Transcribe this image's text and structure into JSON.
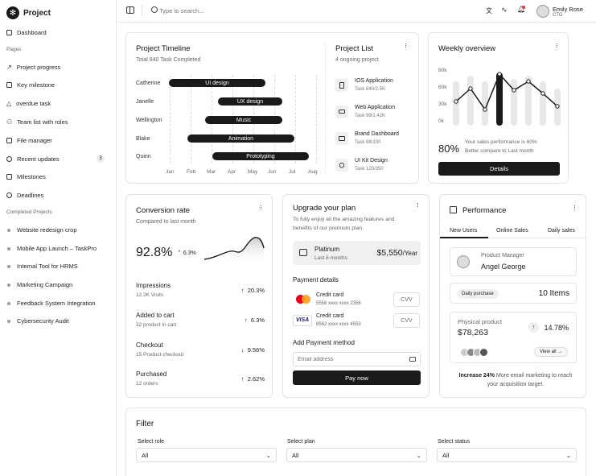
{
  "app": {
    "name": "Project"
  },
  "sidebar": {
    "main": [
      {
        "label": "Dashboard"
      }
    ],
    "pages_header": "Pages",
    "pages": [
      {
        "label": "Project progress"
      },
      {
        "label": "Key milestone"
      },
      {
        "label": "overdue task"
      },
      {
        "label": "Team list with roles"
      },
      {
        "label": "File manager"
      },
      {
        "label": "Recent updates",
        "badge": "3"
      },
      {
        "label": "Milestones"
      },
      {
        "label": "Deadlines"
      }
    ],
    "completed_header": "Completed Projects",
    "completed": [
      {
        "label": "Website redesign  crop"
      },
      {
        "label": "Mobile App Launch – TaskPro"
      },
      {
        "label": "Internal Tool for HRMS"
      },
      {
        "label": "Marketing Campaign"
      },
      {
        "label": "Feedback System Integration"
      },
      {
        "label": "Cybersecurity Audit"
      }
    ]
  },
  "topbar": {
    "search_placeholder": "Type to search...",
    "user_name": "Emily Rose",
    "user_role": "CTO"
  },
  "timeline": {
    "title": "Project Timeline",
    "subtitle": "Total 840 Task Completed",
    "rows": [
      {
        "name": "Catherine",
        "task": "UI design"
      },
      {
        "name": "Janelle",
        "task": "UX design"
      },
      {
        "name": "Wellington",
        "task": "Music"
      },
      {
        "name": "Blake",
        "task": "Animation"
      },
      {
        "name": "Quinn",
        "task": "Prototyping"
      }
    ],
    "months": [
      "Jan",
      "Feb",
      "Mar",
      "Apr",
      "May",
      "Jun",
      "Jul",
      "Aug"
    ]
  },
  "project_list": {
    "title": "Project List",
    "subtitle": "4 ongoing project",
    "items": [
      {
        "name": "IOS Application",
        "meta": "Task 840/2.5K",
        "icon": "phone-icon"
      },
      {
        "name": "Web Application",
        "meta": "Task 99/1.42K",
        "icon": "laptop-icon"
      },
      {
        "name": "Brand Dashboard",
        "meta": "Task 98/100",
        "icon": "card-icon"
      },
      {
        "name": "UI Kit Design",
        "meta": "Task 120/350",
        "icon": "kit-icon"
      }
    ]
  },
  "weekly": {
    "title": "Weekly overview",
    "y_ticks": [
      "60k",
      "60k",
      "30k",
      "0k"
    ],
    "percent": "80%",
    "note_line1": "Your sales performance is 60%",
    "note_line2": "Better compare to Last month",
    "button": "Details"
  },
  "conversion": {
    "title": "Conversion rate",
    "subtitle": "Compared to last month",
    "value": "92.8%",
    "delta": "6.3%",
    "stats": [
      {
        "label": "Impressions",
        "sub": "12.2K Visits",
        "dir": "↑",
        "value": "20.3%"
      },
      {
        "label": "Added to cart",
        "sub": "32 product in cart",
        "dir": "↑",
        "value": "6.3%"
      },
      {
        "label": "Checkout",
        "sub": "15 Product checkout",
        "dir": "↓",
        "value": "9.56%"
      },
      {
        "label": "Purchased",
        "sub": "12 orders",
        "dir": "↑",
        "value": "2.62%"
      }
    ]
  },
  "upgrade": {
    "title": "Upgrade your plan",
    "desc_line1": "To fully enjoy all the amazing features and",
    "desc_line2": "benefits of our premium plan.",
    "plan_name": "Platinum",
    "plan_period": "Last 6 months",
    "plan_price": "$5,550",
    "plan_unit": "/Year",
    "payment_header": "Payment details",
    "cards": [
      {
        "label": "Credit card",
        "number": "5558 xxxx xxxx 2356",
        "cvv": "CVV",
        "brand": "mastercard"
      },
      {
        "label": "Credit card",
        "number": "8562 xxxx xxxx 4553",
        "cvv": "CVV",
        "brand": "VISA"
      }
    ],
    "add_header": "Add Payment method",
    "email_placeholder": "Email address",
    "pay_button": "Pay now"
  },
  "performance": {
    "title": "Performance",
    "tabs": [
      "New Users",
      "Online Sales",
      "Daily sales"
    ],
    "manager_role": "Product Manager",
    "manager_name": "Angel George",
    "daily_label": "Daily purchase",
    "daily_value": "10 Items",
    "physical_label": "Physical product",
    "physical_value": "$78,263",
    "physical_delta": "14.78%",
    "view_all": "View all",
    "footer_bold": "Increase 24%",
    "footer_line1": "More email marketing to reach",
    "footer_line2": "your acquisition target."
  },
  "filter": {
    "title": "Filter",
    "fields": [
      {
        "label": "Select role",
        "value": "All"
      },
      {
        "label": "Select plan",
        "value": "All"
      },
      {
        "label": "Select status",
        "value": "All"
      }
    ]
  },
  "colors": {
    "dark": "#1a1a1a",
    "muted": "#666666",
    "border": "#e5e5e5",
    "bar_light": "#e8e8e8"
  }
}
